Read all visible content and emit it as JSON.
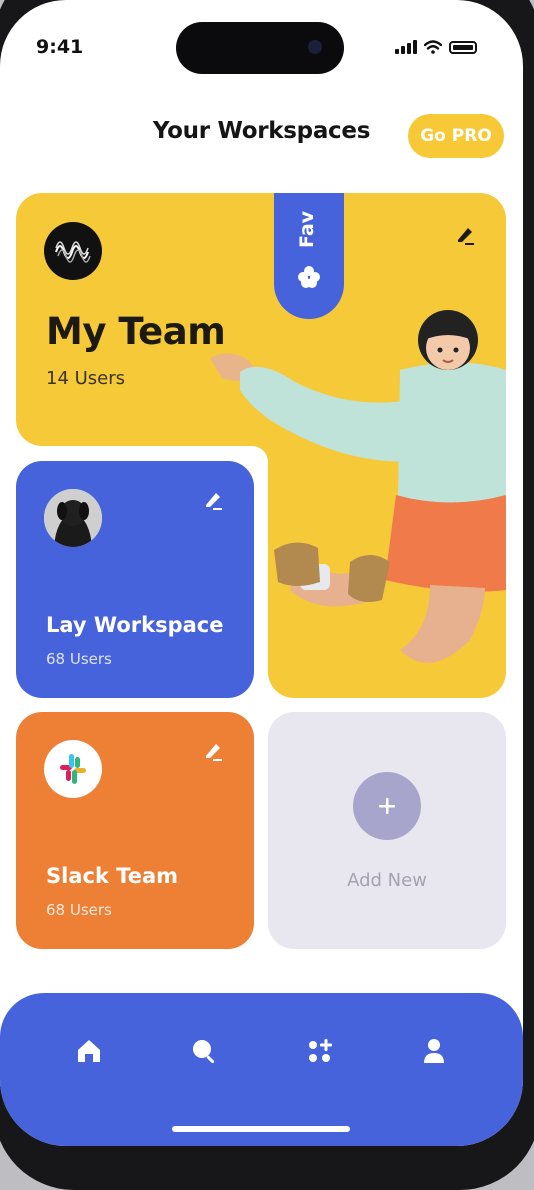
{
  "status_bar": {
    "time": "9:41"
  },
  "header": {
    "title": "Your Workspaces",
    "pro_button": "Go PRO"
  },
  "workspaces": [
    {
      "name": "My Team",
      "users": "14 Users",
      "color": "#f6c939",
      "badge": "Fav",
      "avatar": "logo-avatar",
      "edit_icon": "edit-icon"
    },
    {
      "name": "Lay  Workspace",
      "users": "68 Users",
      "color": "#4663db",
      "avatar": "dog-avatar",
      "edit_icon": "edit-icon"
    },
    {
      "name": "Slack Team",
      "users": "68 Users",
      "color": "#ee8036",
      "avatar": "slack-logo",
      "edit_icon": "edit-icon"
    }
  ],
  "add_new": {
    "label": "Add New",
    "icon": "plus-icon"
  },
  "tab_bar": {
    "color": "#4663db",
    "tabs": [
      {
        "icon": "home-icon"
      },
      {
        "icon": "search-icon"
      },
      {
        "icon": "apps-add-icon"
      },
      {
        "icon": "profile-icon"
      }
    ]
  },
  "colors": {
    "accent": "#f7c937",
    "background": "#ffffff"
  }
}
